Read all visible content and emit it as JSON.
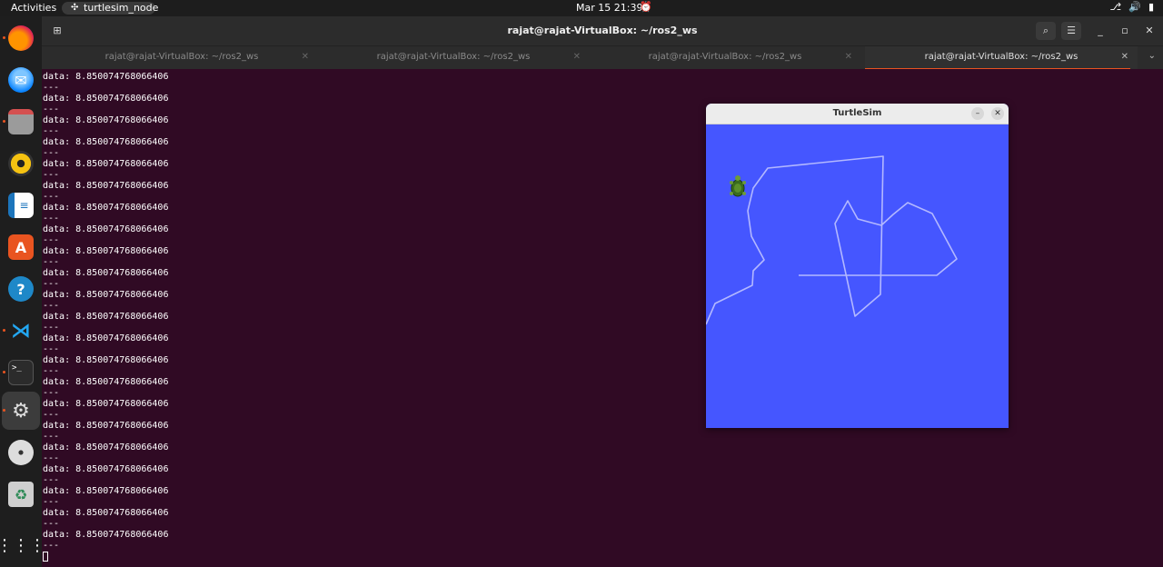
{
  "topbar": {
    "activities": "Activities",
    "app_name": "turtlesim_node",
    "clock": "Mar 15  21:39"
  },
  "dock": {
    "items": [
      "firefox-icon",
      "thunderbird-icon",
      "files-icon",
      "rhythmbox-icon",
      "libreoffice-writer-icon",
      "app-center-icon",
      "help-icon",
      "vscode-icon",
      "terminal-icon",
      "settings-icon",
      "dvd-icon",
      "trash-icon",
      "show-apps-icon"
    ]
  },
  "terminal": {
    "title": "rajat@rajat-VirtualBox: ~/ros2_ws",
    "tabs": [
      {
        "label": "rajat@rajat-VirtualBox: ~/ros2_ws",
        "active": false
      },
      {
        "label": "rajat@rajat-VirtualBox: ~/ros2_ws",
        "active": false
      },
      {
        "label": "rajat@rajat-VirtualBox: ~/ros2_ws",
        "active": false
      },
      {
        "label": "rajat@rajat-VirtualBox: ~/ros2_ws",
        "active": true
      }
    ],
    "data_line": "data: 8.850074768066406",
    "separator": "---",
    "repeat_count": 22
  },
  "turtlesim": {
    "title": "TurtleSim",
    "background_color": "#4556ff",
    "pen_color": "#b3b8ff"
  }
}
